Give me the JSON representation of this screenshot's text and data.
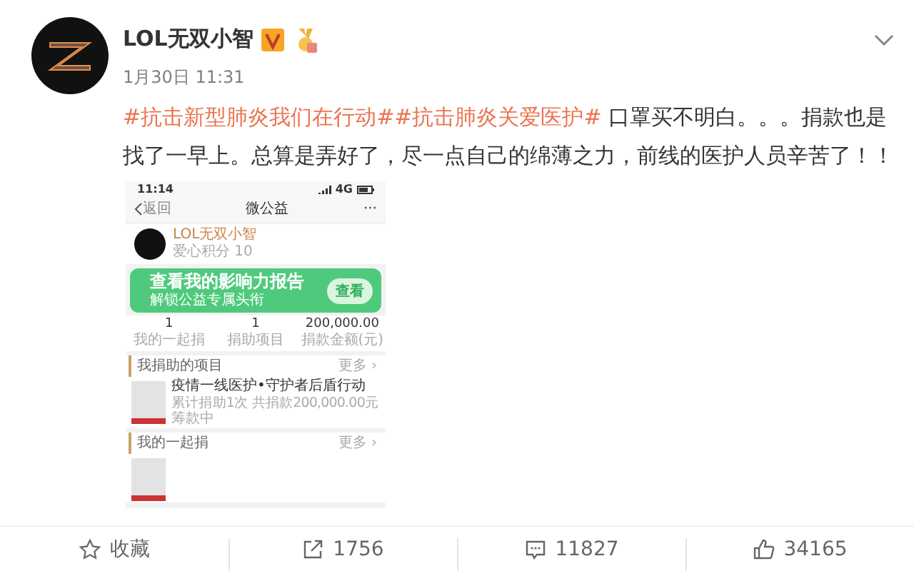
{
  "post": {
    "author": "LOL无双小智",
    "timestamp": "1月30日 11:31",
    "text": [
      {
        "kind": "hashtag",
        "text": "#抗击新型肺炎我们在行动#"
      },
      {
        "kind": "hashtag",
        "text": "#抗击肺炎关爱医护#"
      },
      {
        "kind": "plain",
        "text": " 口罩买不明白。。。捐款也是找了一早上。总算是弄好了，尽一点自己的绵薄之力，前线的医护人员辛苦了！！"
      }
    ]
  },
  "phone_screenshot": {
    "status_time": "11:14",
    "network": "4G",
    "back": "返回",
    "title": "微公益",
    "more": "···",
    "profile": {
      "name": "LOL无双小智",
      "points": "爱心积分 10"
    },
    "banner": {
      "title": "查看我的影响力报告",
      "subtitle": "解锁公益专属头衔",
      "button": "查看"
    },
    "stats": [
      {
        "value": "1",
        "label": "我的一起捐"
      },
      {
        "value": "1",
        "label": "捐助项目"
      },
      {
        "value": "200,000.00",
        "label": "捐款金额(元)"
      }
    ],
    "sections": [
      {
        "title": "我捐助的项目",
        "more": "更多 ›",
        "project": {
          "title": "疫情一线医护•守护者后盾行动",
          "detail": "累计捐助1次 共捐款200,000.00元",
          "status": "筹款中"
        }
      },
      {
        "title": "我的一起捐",
        "more": "更多 ›"
      }
    ]
  },
  "actions": [
    {
      "kind": "favorite",
      "label": "收藏"
    },
    {
      "kind": "repost",
      "label": "1756"
    },
    {
      "kind": "comment",
      "label": "11827"
    },
    {
      "kind": "like",
      "label": "34165"
    }
  ]
}
